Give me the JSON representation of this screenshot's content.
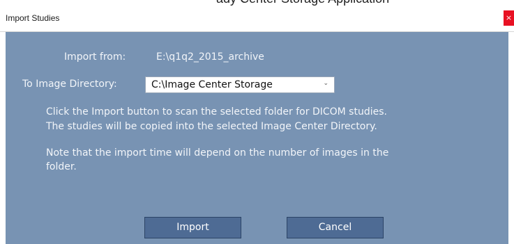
{
  "window": {
    "title": "Import Studies",
    "close_glyph": "×"
  },
  "top_strip_text": "ady Center Storage Application",
  "import_from": {
    "label": "Import from:",
    "value": "E:\\q1q2_2015_archive"
  },
  "image_directory": {
    "label": "To Image Directory:",
    "selected": "C:\\Image Center Storage"
  },
  "description": {
    "line1": "Click the Import button to scan the selected folder for DICOM studies.",
    "line2": "The studies will be copied into the selected Image Center Directory.",
    "note_line1": "Note that the import time will depend on the number of images in the",
    "note_line2": "folder."
  },
  "buttons": {
    "import_label": "Import",
    "cancel_label": "Cancel"
  },
  "colors": {
    "panel_background": "#7893b3",
    "button_background": "#4e6b94",
    "close_button": "#e81123"
  },
  "icons": {
    "close": "close-icon",
    "dropdown": "chevron-down-icon"
  }
}
